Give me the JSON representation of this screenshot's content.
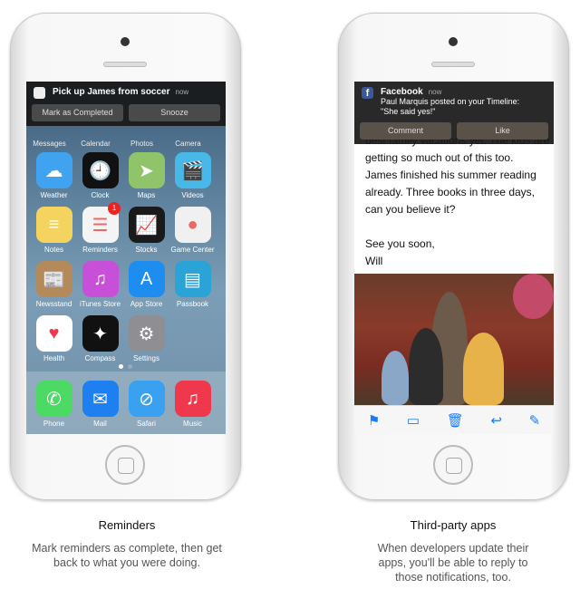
{
  "left": {
    "notification": {
      "title": "Pick up James from soccer",
      "time": "now",
      "actions": [
        "Mark as Completed",
        "Snooze"
      ]
    },
    "dock_labels_peek": [
      "Messages",
      "Calendar",
      "Photos",
      "Camera"
    ],
    "apps": [
      {
        "name": "Weather",
        "icon": "weather-icon",
        "color": "#3fa3f0",
        "glyph": "☁"
      },
      {
        "name": "Clock",
        "icon": "clock-icon",
        "color": "#111111",
        "glyph": "🕘"
      },
      {
        "name": "Maps",
        "icon": "maps-icon",
        "color": "#8fc46a",
        "glyph": "➤"
      },
      {
        "name": "Videos",
        "icon": "videos-icon",
        "color": "#48b8e8",
        "glyph": "🎬"
      },
      {
        "name": "Notes",
        "icon": "notes-icon",
        "color": "#f4d35e",
        "glyph": "≡"
      },
      {
        "name": "Reminders",
        "icon": "reminders-icon",
        "color": "#f4f4f4",
        "glyph": "☰",
        "badge": "1"
      },
      {
        "name": "Stocks",
        "icon": "stocks-icon",
        "color": "#1a1a1a",
        "glyph": "📈"
      },
      {
        "name": "Game Center",
        "icon": "game-center-icon",
        "color": "#f0f0f0",
        "glyph": "●"
      },
      {
        "name": "Newsstand",
        "icon": "newsstand-icon",
        "color": "#b58a5a",
        "glyph": "📰"
      },
      {
        "name": "iTunes Store",
        "icon": "itunes-store-icon",
        "color": "#c84fd8",
        "glyph": "♫"
      },
      {
        "name": "App Store",
        "icon": "app-store-icon",
        "color": "#1d8df0",
        "glyph": "A"
      },
      {
        "name": "Passbook",
        "icon": "passbook-icon",
        "color": "#2aa3d6",
        "glyph": "▤"
      },
      {
        "name": "Health",
        "icon": "health-icon",
        "color": "#ffffff",
        "glyph": "♥"
      },
      {
        "name": "Compass",
        "icon": "compass-icon",
        "color": "#111111",
        "glyph": "✦"
      },
      {
        "name": "Settings",
        "icon": "settings-icon",
        "color": "#8e8e93",
        "glyph": "⚙"
      }
    ],
    "dock": [
      {
        "name": "Phone",
        "icon": "phone-icon",
        "color": "#4cd964",
        "glyph": "✆"
      },
      {
        "name": "Mail",
        "icon": "mail-icon",
        "color": "#1e7ff0",
        "glyph": "✉"
      },
      {
        "name": "Safari",
        "icon": "safari-icon",
        "color": "#3aa0f0",
        "glyph": "⊘"
      },
      {
        "name": "Music",
        "icon": "music-icon",
        "color": "#f0384c",
        "glyph": "♫"
      }
    ]
  },
  "right": {
    "notification": {
      "title": "Facebook",
      "time": "now",
      "line1": "Paul Marquis posted on your Timeline:",
      "line2": "\"She said yes!\"",
      "actions": [
        "Comment",
        "Like"
      ]
    },
    "mail_lines": [
      "best family vacations yet. The kids are",
      "getting so much out of this too.",
      "James finished his summer reading",
      "already. Three books in three days,",
      "can you believe it?",
      "",
      "See you soon,",
      "Will"
    ],
    "toolbar": [
      "flag-icon",
      "folder-icon",
      "trash-icon",
      "reply-icon",
      "compose-icon"
    ]
  },
  "captions": [
    {
      "title": "Reminders",
      "text": "Mark reminders as complete, then get back to what you were doing."
    },
    {
      "title": "Third-party apps",
      "text": "When developers update their apps, you'll be able to reply to those notifications, too."
    }
  ]
}
